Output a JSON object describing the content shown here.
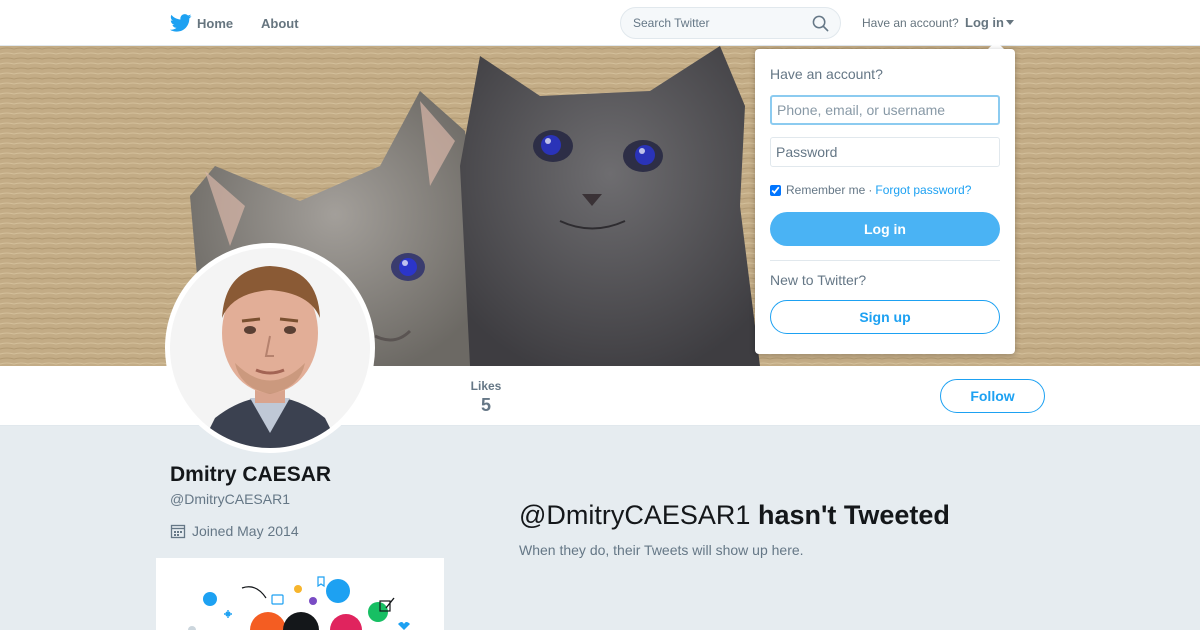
{
  "nav": {
    "home_label": "Home",
    "about_label": "About",
    "search_placeholder": "Search Twitter",
    "have_account": "Have an account?",
    "login_label": "Log in"
  },
  "profile": {
    "name": "Dmitry CAESAR",
    "handle": "@DmitryCAESAR1",
    "joined": "Joined May 2014",
    "stats": [
      {
        "label": "Likes",
        "value": "5"
      }
    ],
    "follow_label": "Follow"
  },
  "timeline": {
    "empty_handle": "@DmitryCAESAR1",
    "empty_title": "hasn't Tweeted",
    "empty_sub": "When they do, their Tweets will show up here."
  },
  "login_dropdown": {
    "heading": "Have an account?",
    "username_placeholder": "Phone, email, or username",
    "password_placeholder": "Password",
    "remember_label": "Remember me",
    "separator": "·",
    "forgot_label": "Forgot password?",
    "login_button": "Log in",
    "new_heading": "New to Twitter?",
    "signup_button": "Sign up"
  },
  "colors": {
    "brand_blue": "#1da1f2",
    "login_button": "#4ab3f4",
    "page_bg": "#e6ecf0",
    "muted_text": "#657786"
  },
  "icons": {
    "logo": "twitter-bird-icon",
    "search": "search-icon",
    "caret": "caret-down-icon",
    "calendar": "calendar-icon"
  }
}
